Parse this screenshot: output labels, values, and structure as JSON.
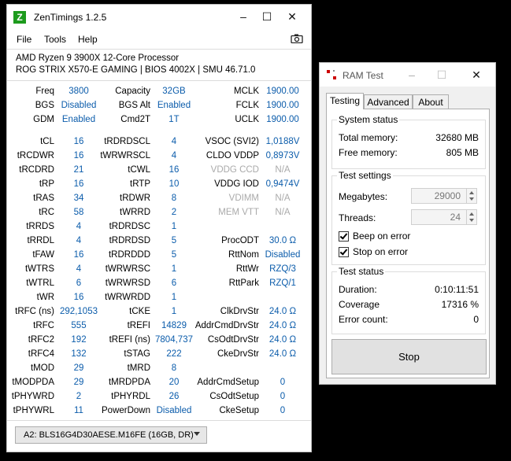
{
  "zentimings": {
    "title": "ZenTimings 1.2.5",
    "logo_letter": "Z",
    "menu": [
      "File",
      "Tools",
      "Help"
    ],
    "cpu": "AMD Ryzen 9 3900X 12-Core Processor",
    "board": "ROG STRIX X570-E GAMING | BIOS 4002X | SMU 46.71.0",
    "rows": [
      {
        "l1": "Freq",
        "v1": "3800",
        "l2": "Capacity",
        "v2": "32GB",
        "l3": "MCLK",
        "v3": "1900.00"
      },
      {
        "l1": "BGS",
        "v1": "Disabled",
        "l2": "BGS Alt",
        "v2": "Enabled",
        "l3": "FCLK",
        "v3": "1900.00"
      },
      {
        "l1": "GDM",
        "v1": "Enabled",
        "l2": "Cmd2T",
        "v2": "1T",
        "l3": "UCLK",
        "v3": "1900.00"
      },
      {
        "l1": "tCL",
        "v1": "16",
        "l2": "tRDRDSCL",
        "v2": "4",
        "l3": "VSOC (SVI2)",
        "v3": "1,0188V"
      },
      {
        "l1": "tRCDWR",
        "v1": "16",
        "l2": "tWRWRSCL",
        "v2": "4",
        "l3": "CLDO VDDP",
        "v3": "0,8973V"
      },
      {
        "l1": "tRCDRD",
        "v1": "21",
        "l2": "tCWL",
        "v2": "16",
        "l3": "VDDG CCD",
        "v3": "N/A",
        "dim3": true
      },
      {
        "l1": "tRP",
        "v1": "16",
        "l2": "tRTP",
        "v2": "10",
        "l3": "VDDG IOD",
        "v3": "0,9474V"
      },
      {
        "l1": "tRAS",
        "v1": "34",
        "l2": "tRDWR",
        "v2": "8",
        "l3": "VDIMM",
        "v3": "N/A",
        "dim3": true
      },
      {
        "l1": "tRC",
        "v1": "58",
        "l2": "tWRRD",
        "v2": "2",
        "l3": "MEM VTT",
        "v3": "N/A",
        "dim3": true
      },
      {
        "l1": "tRRDS",
        "v1": "4",
        "l2": "tRDRDSC",
        "v2": "1",
        "l3": "",
        "v3": ""
      },
      {
        "l1": "tRRDL",
        "v1": "4",
        "l2": "tRDRDSD",
        "v2": "5",
        "l3": "ProcODT",
        "v3": "30.0 Ω"
      },
      {
        "l1": "tFAW",
        "v1": "16",
        "l2": "tRDRDDD",
        "v2": "5",
        "l3": "RttNom",
        "v3": "Disabled"
      },
      {
        "l1": "tWTRS",
        "v1": "4",
        "l2": "tWRWRSC",
        "v2": "1",
        "l3": "RttWr",
        "v3": "RZQ/3"
      },
      {
        "l1": "tWTRL",
        "v1": "6",
        "l2": "tWRWRSD",
        "v2": "6",
        "l3": "RttPark",
        "v3": "RZQ/1"
      },
      {
        "l1": "tWR",
        "v1": "16",
        "l2": "tWRWRDD",
        "v2": "1",
        "l3": "",
        "v3": ""
      },
      {
        "l1": "tRFC (ns)",
        "v1": "292,1053",
        "l2": "tCKE",
        "v2": "1",
        "l3": "ClkDrvStr",
        "v3": "24.0 Ω"
      },
      {
        "l1": "tRFC",
        "v1": "555",
        "l2": "tREFI",
        "v2": "14829",
        "l3": "AddrCmdDrvStr",
        "v3": "24.0 Ω"
      },
      {
        "l1": "tRFC2",
        "v1": "192",
        "l2": "tREFI (ns)",
        "v2": "7804,737",
        "l3": "CsOdtDrvStr",
        "v3": "24.0 Ω"
      },
      {
        "l1": "tRFC4",
        "v1": "132",
        "l2": "tSTAG",
        "v2": "222",
        "l3": "CkeDrvStr",
        "v3": "24.0 Ω"
      },
      {
        "l1": "tMOD",
        "v1": "29",
        "l2": "tMRD",
        "v2": "8",
        "l3": "",
        "v3": ""
      },
      {
        "l1": "tMODPDA",
        "v1": "29",
        "l2": "tMRDPDA",
        "v2": "20",
        "l3": "AddrCmdSetup",
        "v3": "0"
      },
      {
        "l1": "tPHYWRD",
        "v1": "2",
        "l2": "tPHYRDL",
        "v2": "26",
        "l3": "CsOdtSetup",
        "v3": "0"
      },
      {
        "l1": "tPHYWRL",
        "v1": "11",
        "l2": "PowerDown",
        "v2": "Disabled",
        "l3": "CkeSetup",
        "v3": "0"
      }
    ],
    "dimm": "A2: BLS16G4D30AESE.M16FE (16GB, DR)"
  },
  "ramtest": {
    "title": "RAM Test",
    "tabs": [
      "Testing",
      "Advanced",
      "About"
    ],
    "system_status": {
      "title": "System status",
      "total_label": "Total memory:",
      "total_value": "32680 MB",
      "free_label": "Free memory:",
      "free_value": "805 MB"
    },
    "test_settings": {
      "title": "Test settings",
      "megabytes_label": "Megabytes:",
      "megabytes_value": "29000",
      "threads_label": "Threads:",
      "threads_value": "24",
      "beep_label": "Beep on error",
      "beep_checked": true,
      "stop_label": "Stop on error",
      "stop_checked": true
    },
    "test_status": {
      "title": "Test status",
      "duration_label": "Duration:",
      "duration_value": "0:10:11:51",
      "coverage_label": "Coverage",
      "coverage_value": "17316 %",
      "errors_label": "Error count:",
      "errors_value": "0"
    },
    "stop_button": "Stop"
  },
  "colors": {
    "value_blue": "#0b5cab",
    "dim_gray": "#aaaaaa",
    "logo_green": "#1d9b1d"
  }
}
